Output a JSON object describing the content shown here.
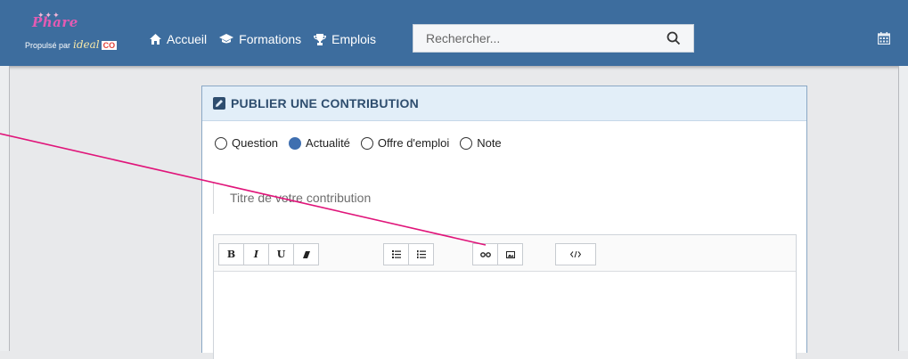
{
  "header": {
    "brand": "Phare",
    "sub_prefix": "Propulsé par",
    "sub_brand": "ideal",
    "sub_co": "CO",
    "nav": [
      {
        "label": "Accueil",
        "icon": "home-icon"
      },
      {
        "label": "Formations",
        "icon": "graduation-cap-icon"
      },
      {
        "label": "Emplois",
        "icon": "trophy-icon"
      }
    ],
    "search_placeholder": "Rechercher...",
    "right_icon": "calendar-icon"
  },
  "card": {
    "title": "PUBLIER UNE CONTRIBUTION",
    "types": [
      {
        "label": "Question",
        "checked": false
      },
      {
        "label": "Actualité",
        "checked": true
      },
      {
        "label": "Offre d'emploi",
        "checked": false
      },
      {
        "label": "Note",
        "checked": false
      }
    ],
    "title_placeholder": "Titre de votre contribution",
    "toolbar": {
      "bold": "B",
      "italic": "I",
      "underline": "U"
    }
  },
  "colors": {
    "navbar": "#3d6d9e",
    "accent": "#3f6fb0",
    "pointer": "#e0157a"
  }
}
